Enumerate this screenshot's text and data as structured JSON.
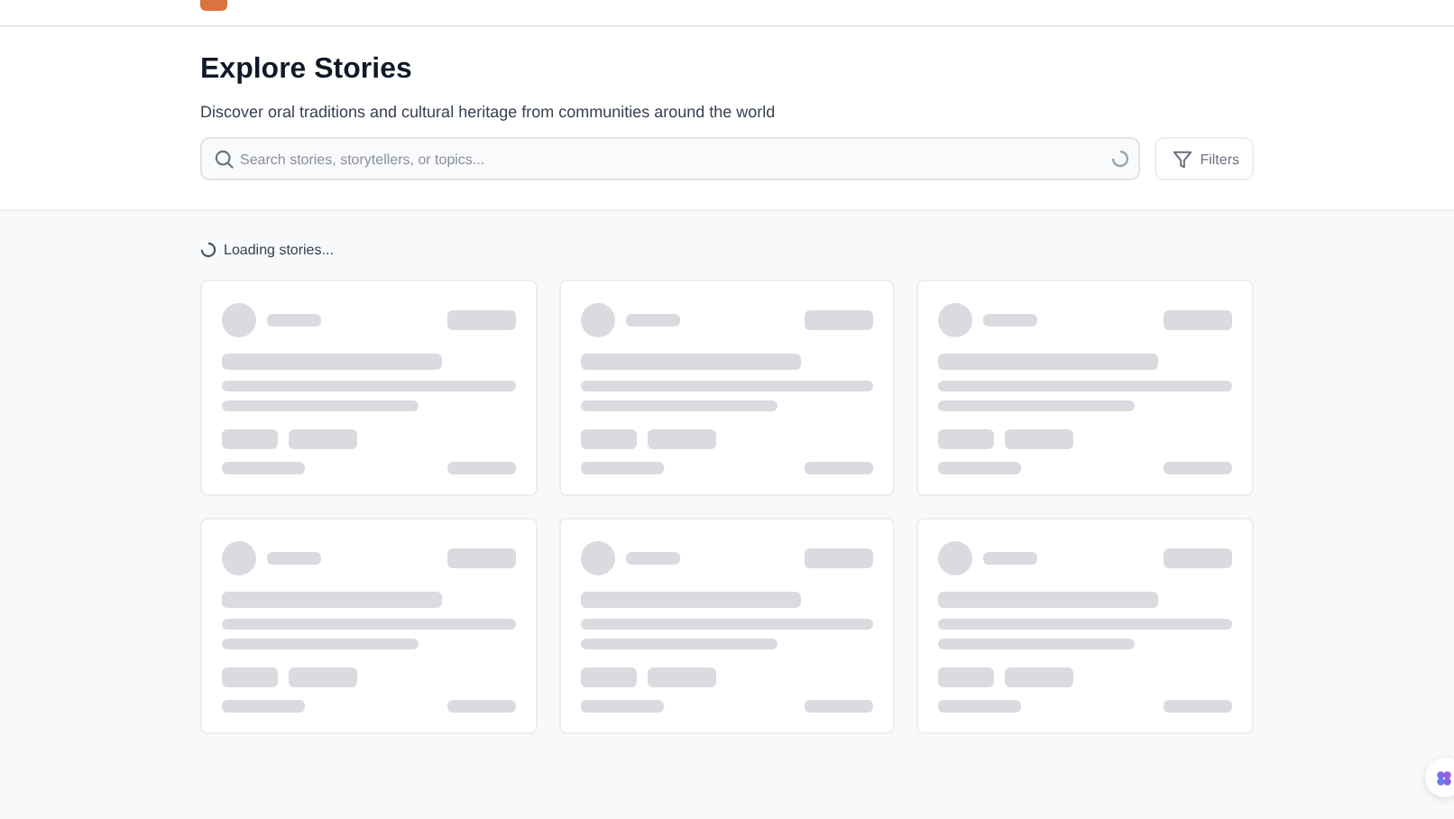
{
  "header": {
    "logo": true
  },
  "page": {
    "title": "Explore Stories",
    "subtitle": "Discover oral traditions and cultural heritage from communities around the world"
  },
  "search": {
    "placeholder": "Search stories, storytellers, or topics...",
    "loading": true
  },
  "filters_button": {
    "label": "Filters"
  },
  "status": {
    "text": "Loading stories..."
  },
  "cards": [
    {
      "kind": "skeleton"
    },
    {
      "kind": "skeleton"
    },
    {
      "kind": "skeleton"
    },
    {
      "kind": "skeleton"
    },
    {
      "kind": "skeleton"
    },
    {
      "kind": "skeleton"
    }
  ]
}
